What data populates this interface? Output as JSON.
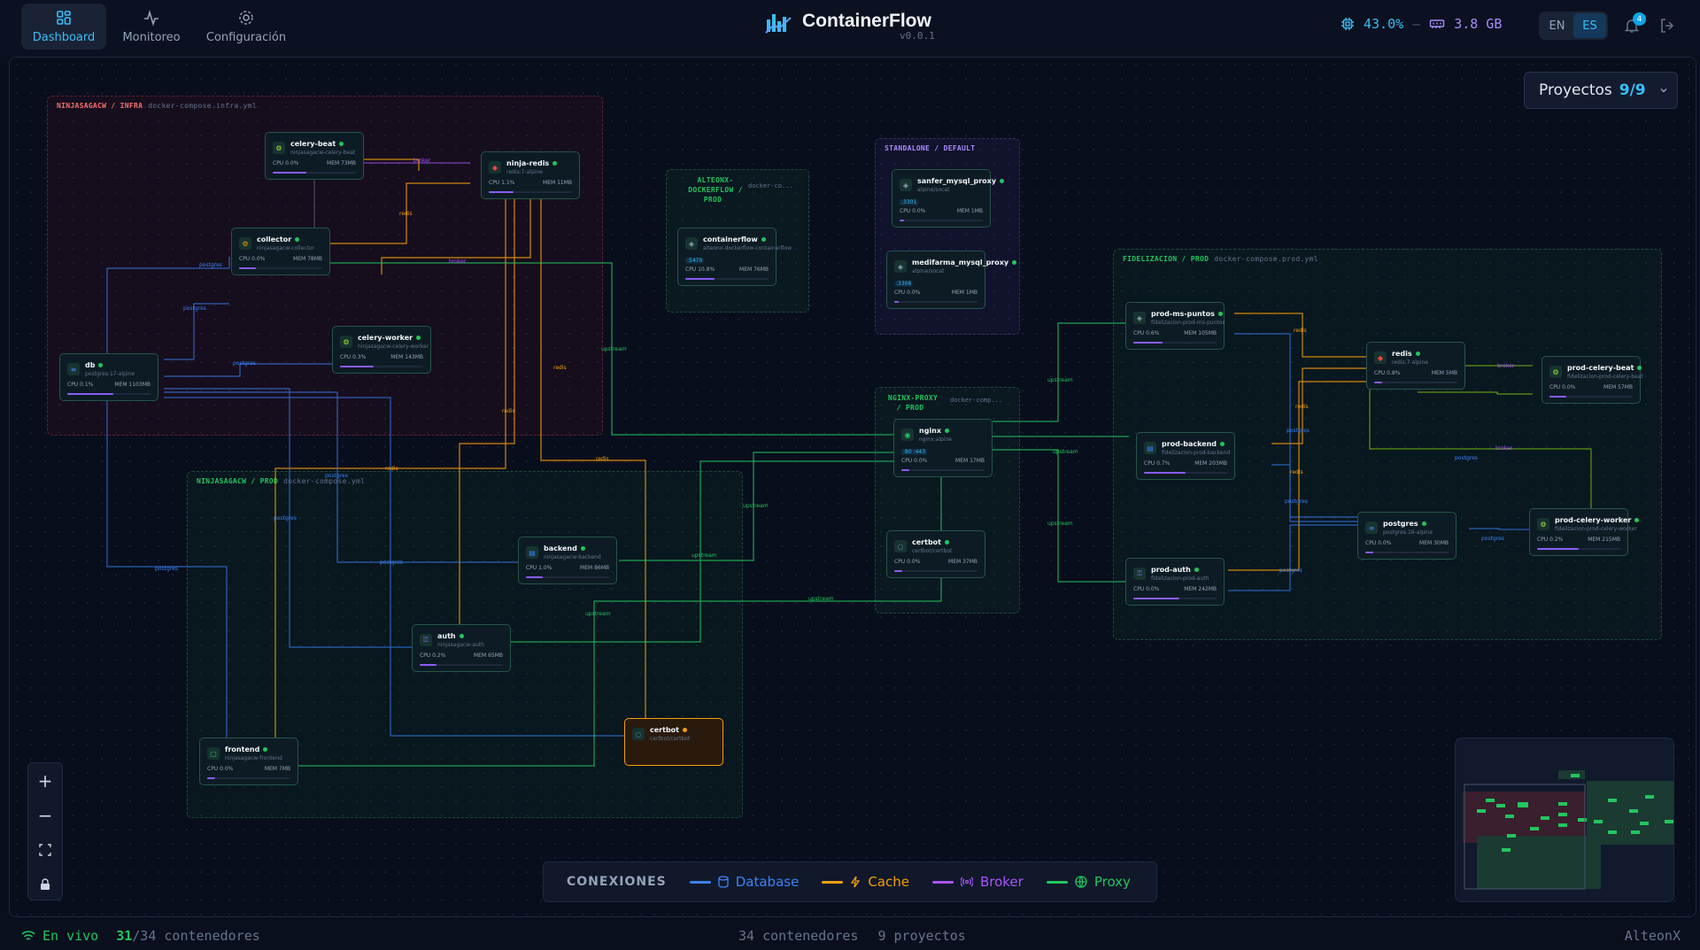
{
  "nav": {
    "tabs": [
      {
        "label": "Dashboard",
        "icon": "grid-icon"
      },
      {
        "label": "Monitoreo",
        "icon": "activity-icon"
      },
      {
        "label": "Configuración",
        "icon": "gear-icon"
      }
    ]
  },
  "brand": {
    "name": "ContainerFlow",
    "version": "v0.0.1"
  },
  "stats": {
    "cpu": "43.0%",
    "sep": "–",
    "mem": "3.8 GB",
    "notifications": "4"
  },
  "lang": {
    "en": "EN",
    "es": "ES"
  },
  "projects": {
    "label": "Proyectos",
    "count": "9/9"
  },
  "groups": {
    "infra": {
      "name": "NINJASAGACW / INFRA",
      "file": "docker-compose.infra.yml"
    },
    "prod": {
      "name": "NINJASAGACW / PROD",
      "file": "docker-compose.yml"
    },
    "alteonx": {
      "name": "ALTEONX-DOCKERFLOW / PROD",
      "file": "docker-co..."
    },
    "standalone": {
      "name": "STANDALONE / DEFAULT"
    },
    "nginx": {
      "name": "NGINX-PROXY / PROD",
      "file": "docker-comp..."
    },
    "fidel": {
      "name": "FIDELIZACION / PROD",
      "file": "docker-compose.prod.yml"
    }
  },
  "nodes": [
    {
      "name": "celery-beat",
      "img": "ninjasagacw-celery-beat",
      "cpu": "CPU 0.0%",
      "mem": "MEM 73MB",
      "bar": 0.4,
      "icon": "⚙",
      "ic": "#a3e635"
    },
    {
      "name": "ninja-redis",
      "img": "redis:7-alpine",
      "cpu": "CPU 1.1%",
      "mem": "MEM 11MB",
      "bar": 0.3,
      "icon": "◆",
      "ic": "#ef4444"
    },
    {
      "name": "collector",
      "img": "ninjasagacw-collector",
      "cpu": "CPU 0.0%",
      "mem": "MEM 78MB",
      "bar": 0.2,
      "icon": "⚙",
      "ic": "#f59e0b"
    },
    {
      "name": "celery-worker",
      "img": "ninjasagacw-celery-worker",
      "cpu": "CPU 0.3%",
      "mem": "MEM 143MB",
      "bar": 0.4,
      "icon": "⚙",
      "ic": "#a3e635"
    },
    {
      "name": "db",
      "img": "postgres:17-alpine",
      "cpu": "CPU 0.1%",
      "mem": "MEM 1103MB",
      "bar": 0.55,
      "icon": "≡",
      "ic": "#3b82f6"
    },
    {
      "name": "containerflow",
      "img": "alteonx-dockerflow-containerflow",
      "port": ":5470",
      "cpu": "CPU 10.8%",
      "mem": "MEM 76MB",
      "bar": 0.35,
      "icon": "◈",
      "ic": "#94a3b8"
    },
    {
      "name": "sanfer_mysql_proxy",
      "img": "alpine/socat",
      "port": ":3301",
      "cpu": "CPU 0.0%",
      "mem": "MEM 1MB",
      "bar": 0.05,
      "icon": "◈",
      "ic": "#94a3b8"
    },
    {
      "name": "medifarma_mysql_proxy",
      "img": "alpine/socat",
      "port": ":3306",
      "cpu": "CPU 0.0%",
      "mem": "MEM 1MB",
      "bar": 0.05,
      "icon": "◈",
      "ic": "#94a3b8"
    },
    {
      "name": "nginx",
      "img": "nginx:alpine",
      "port": ":80 :443",
      "cpu": "CPU 0.0%",
      "mem": "MEM 17MB",
      "bar": 0.1,
      "icon": "◉",
      "ic": "#22c55e"
    },
    {
      "name": "certbot",
      "img": "certbot/certbot",
      "cpu": "CPU 0.0%",
      "mem": "MEM 37MB",
      "bar": 0.1,
      "icon": "○",
      "ic": "#64748b"
    },
    {
      "name": "backend",
      "img": "ninjasagacw-backend",
      "cpu": "CPU 1.0%",
      "mem": "MEM 86MB",
      "bar": 0.2,
      "icon": "▤",
      "ic": "#3b82f6"
    },
    {
      "name": "auth",
      "img": "ninjasagacw-auth",
      "cpu": "CPU 0.2%",
      "mem": "MEM 65MB",
      "bar": 0.2,
      "icon": "⚿",
      "ic": "#8b5cf6"
    },
    {
      "name": "certbot",
      "img": "certbot/certbot",
      "cpu": "",
      "mem": "",
      "bar": 0,
      "icon": "○",
      "ic": "#64748b"
    },
    {
      "name": "frontend",
      "img": "ninjasagacw-frontend",
      "cpu": "CPU 0.0%",
      "mem": "MEM 7MB",
      "bar": 0.1,
      "icon": "▢",
      "ic": "#22c55e"
    },
    {
      "name": "prod-ms-puntos",
      "img": "fidelizacion-prod-ms-puntos",
      "cpu": "CPU 0.6%",
      "mem": "MEM 105MB",
      "bar": 0.35,
      "icon": "◈",
      "ic": "#94a3b8"
    },
    {
      "name": "redis",
      "img": "redis:7-alpine",
      "cpu": "CPU 0.8%",
      "mem": "MEM 5MB",
      "bar": 0.1,
      "icon": "◆",
      "ic": "#ef4444"
    },
    {
      "name": "prod-celery-beat",
      "img": "fidelizacion-prod-celery-beat",
      "cpu": "CPU 0.0%",
      "mem": "MEM 57MB",
      "bar": 0.2,
      "icon": "⚙",
      "ic": "#a3e635"
    },
    {
      "name": "prod-backend",
      "img": "fidelizacion-prod-backend",
      "cpu": "CPU 0.7%",
      "mem": "MEM 203MB",
      "bar": 0.5,
      "icon": "▤",
      "ic": "#3b82f6"
    },
    {
      "name": "postgres",
      "img": "postgres:16-alpine",
      "cpu": "CPU 0.0%",
      "mem": "MEM 30MB",
      "bar": 0.1,
      "icon": "≡",
      "ic": "#3b82f6"
    },
    {
      "name": "prod-celery-worker",
      "img": "fidelizacion-prod-celery-worker",
      "cpu": "CPU 0.2%",
      "mem": "MEM 215MB",
      "bar": 0.5,
      "icon": "⚙",
      "ic": "#a3e635"
    },
    {
      "name": "prod-auth",
      "img": "fidelizacion-prod-auth",
      "cpu": "CPU 0.0%",
      "mem": "MEM 242MB",
      "bar": 0.55,
      "icon": "⚿",
      "ic": "#8b5cf6"
    }
  ],
  "edge_labels": {
    "broker": "broker",
    "redis": "redis",
    "postgres": "postgres",
    "upstream": "upstream"
  },
  "legend": {
    "title": "CONEXIONES",
    "items": [
      {
        "label": "Database",
        "color": "#3b82f6"
      },
      {
        "label": "Cache",
        "color": "#f59e0b"
      },
      {
        "label": "Broker",
        "color": "#a855f7"
      },
      {
        "label": "Proxy",
        "color": "#22c55e"
      }
    ]
  },
  "zoom": {
    "plus": "+",
    "minus": "−"
  },
  "status": {
    "live": "En vivo",
    "running": "31",
    "total_running": "/34 contenedores",
    "containers": "34 contenedores",
    "projects": "9 proyectos",
    "brand": "AlteonX"
  }
}
